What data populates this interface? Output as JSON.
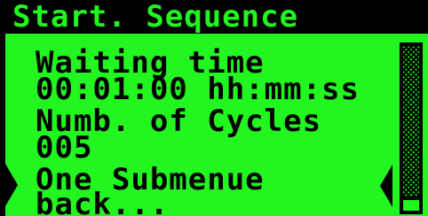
{
  "header": {
    "title": "Start. Sequence"
  },
  "menu": {
    "items": [
      {
        "label": "Waiting time",
        "value": "00:01:00 hh:mm:ss"
      },
      {
        "label": "Numb. of Cycles",
        "value": "005"
      },
      {
        "label": "One Submenue",
        "value": "back..."
      }
    ],
    "selected_index": 2
  },
  "scrollbar": {
    "position_fraction": 1.0
  },
  "colors": {
    "screen": "#22f51f",
    "ink": "#000000"
  }
}
